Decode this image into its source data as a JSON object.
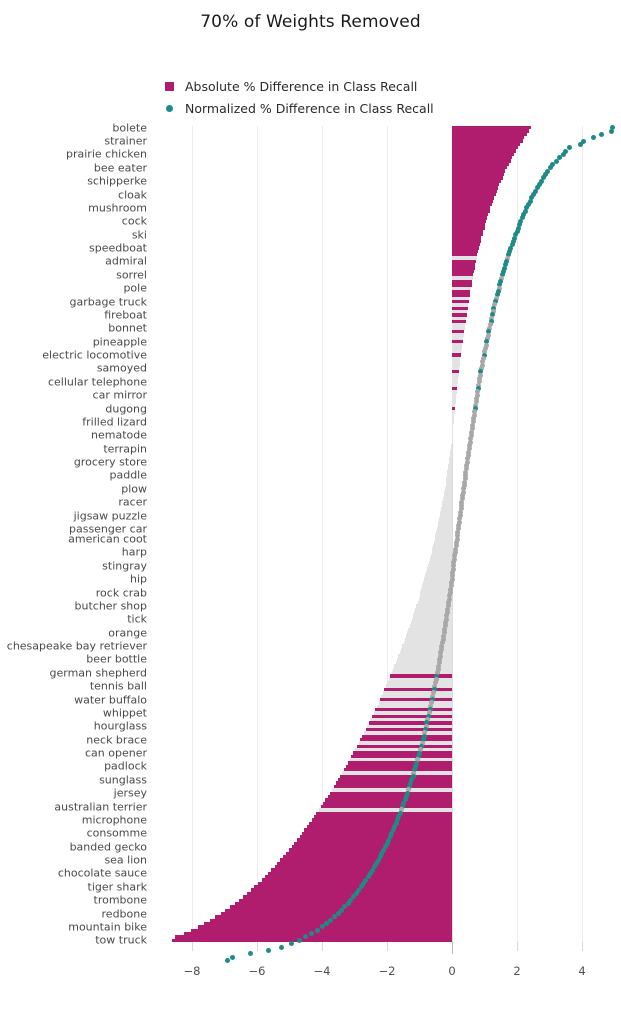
{
  "title": "70% of Weights Removed",
  "colors": {
    "absolute": "#b01c6e",
    "normalized": "#1f8a87",
    "nonsignificant_bar": "#e3e3e3",
    "nonsignificant_dot": "#a8a8a8",
    "grid": "#ececec",
    "background": "#ffffff"
  },
  "legend": {
    "position": "top-left",
    "items": [
      {
        "label": "Absolute % Difference in Class Recall",
        "marker": "square",
        "color": "#b01c6e"
      },
      {
        "label": "Normalized % Difference in Class Recall",
        "marker": "circle",
        "color": "#1f8a87"
      }
    ]
  },
  "xaxis": {
    "ticks": [
      -8,
      -6,
      -4,
      -2,
      0,
      2,
      4
    ],
    "tick_labels": [
      "−8",
      "−6",
      "−4",
      "−2",
      "0",
      "2",
      "4"
    ],
    "range": [
      -9.2,
      5.2
    ],
    "label": ""
  },
  "yaxis": {
    "label": "",
    "tick_labels": [
      "bolete",
      "strainer",
      "prairie chicken",
      "bee eater",
      "schipperke",
      "cloak",
      "mushroom",
      "cock",
      "ski",
      "speedboat",
      "admiral",
      "sorrel",
      "pole",
      "garbage truck",
      "fireboat",
      "bonnet",
      "pineapple",
      "electric locomotive",
      "samoyed",
      "cellular telephone",
      "car mirror",
      "dugong",
      "frilled lizard",
      "nematode",
      "terrapin",
      "grocery store",
      "paddle",
      "plow",
      "racer",
      "jigsaw puzzle",
      "passenger car",
      "american coot",
      "harp",
      "stingray",
      "hip",
      "rock crab",
      "butcher shop",
      "tick",
      "orange",
      "chesapeake bay retriever",
      "beer bottle",
      "german shepherd",
      "tennis ball",
      "water buffalo",
      "whippet",
      "hourglass",
      "neck brace",
      "can opener",
      "padlock",
      "sunglass",
      "jersey",
      "australian terrier",
      "microphone",
      "consomme",
      "banded gecko",
      "sea lion",
      "chocolate sauce",
      "tiger shark",
      "trombone",
      "redbone",
      "mountain bike",
      "tow truck"
    ]
  },
  "chart_data": {
    "type": "bar",
    "title": "70% of Weights Removed",
    "xlabel": "",
    "ylabel": "",
    "xlim": [
      -9.2,
      5.2
    ],
    "grid": true,
    "orientation": "horizontal",
    "n_rows": 248,
    "note": "Sorted diverging bar chart of per-class recall differences; bars = absolute % difference (magenta when significant, light grey otherwise), overlaid dots = normalized % difference (teal when significant, grey otherwise). Labelled ticks shown for every 4th row.",
    "series": [
      {
        "name": "Absolute % Difference in Class Recall",
        "color": "#b01c6e",
        "type": "bar",
        "values": [
          2.42,
          2.36,
          2.31,
          2.22,
          2.18,
          2.1,
          2.04,
          1.98,
          1.9,
          1.86,
          1.8,
          1.76,
          1.7,
          1.64,
          1.6,
          1.56,
          1.5,
          1.46,
          1.42,
          1.38,
          1.34,
          1.3,
          1.26,
          1.22,
          1.18,
          1.16,
          1.12,
          1.08,
          1.06,
          1.02,
          1.0,
          0.96,
          0.94,
          0.9,
          0.88,
          0.86,
          0.82,
          0.8,
          0.78,
          0.76,
          0.74,
          0.72,
          0.7,
          0.68,
          0.66,
          0.64,
          0.62,
          0.6,
          0.58,
          0.56,
          0.55,
          0.53,
          0.51,
          0.5,
          0.48,
          0.46,
          0.45,
          0.43,
          0.42,
          0.4,
          0.39,
          0.37,
          0.36,
          0.34,
          0.33,
          0.32,
          0.3,
          0.29,
          0.28,
          0.26,
          0.25,
          0.24,
          0.22,
          0.21,
          0.2,
          0.19,
          0.18,
          0.16,
          0.15,
          0.14,
          0.13,
          0.12,
          0.11,
          0.1,
          0.09,
          0.08,
          0.07,
          0.06,
          0.05,
          0.04,
          0.03,
          0.02,
          0.01,
          0.0,
          -0.01,
          -0.02,
          -0.04,
          -0.05,
          -0.06,
          -0.08,
          -0.09,
          -0.11,
          -0.12,
          -0.14,
          -0.15,
          -0.17,
          -0.19,
          -0.2,
          -0.22,
          -0.24,
          -0.26,
          -0.28,
          -0.3,
          -0.32,
          -0.34,
          -0.36,
          -0.38,
          -0.4,
          -0.42,
          -0.44,
          -0.46,
          -0.49,
          -0.51,
          -0.53,
          -0.56,
          -0.58,
          -0.61,
          -0.63,
          -0.66,
          -0.68,
          -0.71,
          -0.74,
          -0.76,
          -0.79,
          -0.82,
          -0.85,
          -0.88,
          -0.91,
          -0.94,
          -0.97,
          -1.0,
          -1.03,
          -1.06,
          -1.1,
          -1.13,
          -1.16,
          -1.2,
          -1.23,
          -1.27,
          -1.3,
          -1.34,
          -1.38,
          -1.41,
          -1.45,
          -1.49,
          -1.53,
          -1.57,
          -1.61,
          -1.65,
          -1.69,
          -1.73,
          -1.77,
          -1.81,
          -1.86,
          -1.9,
          -1.94,
          -1.99,
          -2.03,
          -2.08,
          -2.12,
          -2.17,
          -2.22,
          -2.26,
          -2.31,
          -2.36,
          -2.41,
          -2.46,
          -2.51,
          -2.56,
          -2.61,
          -2.66,
          -2.71,
          -2.77,
          -2.82,
          -2.87,
          -2.93,
          -2.98,
          -3.04,
          -3.1,
          -3.15,
          -3.21,
          -3.27,
          -3.33,
          -3.39,
          -3.45,
          -3.51,
          -3.57,
          -3.64,
          -3.7,
          -3.76,
          -3.83,
          -3.9,
          -3.96,
          -4.03,
          -4.1,
          -4.17,
          -4.24,
          -4.31,
          -4.39,
          -4.46,
          -4.54,
          -4.61,
          -4.69,
          -4.77,
          -4.85,
          -4.93,
          -5.02,
          -5.1,
          -5.19,
          -5.28,
          -5.37,
          -5.46,
          -5.56,
          -5.66,
          -5.76,
          -5.86,
          -5.97,
          -6.08,
          -6.19,
          -6.31,
          -6.43,
          -6.56,
          -6.69,
          -6.83,
          -6.97,
          -7.12,
          -7.28,
          -7.45,
          -7.63,
          -7.82,
          -8.03,
          -8.26,
          -8.52,
          -8.62
        ]
      },
      {
        "name": "Normalized % Difference in Class Recall",
        "color": "#1f8a87",
        "type": "scatter",
        "values": [
          4.95,
          4.9,
          4.6,
          4.35,
          4.05,
          3.95,
          3.6,
          3.5,
          3.42,
          3.3,
          3.2,
          3.1,
          3.02,
          2.95,
          2.88,
          2.8,
          2.74,
          2.68,
          2.62,
          2.56,
          2.5,
          2.45,
          2.4,
          2.35,
          2.3,
          2.25,
          2.2,
          2.16,
          2.12,
          2.08,
          2.04,
          2.0,
          1.96,
          1.92,
          1.88,
          1.85,
          1.81,
          1.78,
          1.74,
          1.71,
          1.68,
          1.65,
          1.62,
          1.59,
          1.56,
          1.53,
          1.5,
          1.47,
          1.45,
          1.42,
          1.39,
          1.37,
          1.34,
          1.32,
          1.29,
          1.27,
          1.24,
          1.22,
          1.2,
          1.17,
          1.15,
          1.13,
          1.11,
          1.09,
          1.07,
          1.05,
          1.03,
          1.01,
          0.99,
          0.97,
          0.95,
          0.93,
          0.91,
          0.89,
          0.88,
          0.86,
          0.84,
          0.82,
          0.81,
          0.79,
          0.77,
          0.76,
          0.74,
          0.72,
          0.71,
          0.69,
          0.68,
          0.66,
          0.65,
          0.63,
          0.62,
          0.6,
          0.59,
          0.57,
          0.56,
          0.54,
          0.53,
          0.51,
          0.5,
          0.48,
          0.47,
          0.46,
          0.44,
          0.43,
          0.41,
          0.4,
          0.39,
          0.37,
          0.36,
          0.34,
          0.33,
          0.32,
          0.3,
          0.29,
          0.28,
          0.26,
          0.25,
          0.24,
          0.22,
          0.21,
          0.2,
          0.18,
          0.17,
          0.16,
          0.14,
          0.13,
          0.12,
          0.1,
          0.09,
          0.08,
          0.06,
          0.05,
          0.04,
          0.02,
          0.01,
          0.0,
          -0.02,
          -0.03,
          -0.04,
          -0.06,
          -0.07,
          -0.09,
          -0.1,
          -0.12,
          -0.13,
          -0.15,
          -0.16,
          -0.18,
          -0.19,
          -0.21,
          -0.22,
          -0.24,
          -0.26,
          -0.27,
          -0.29,
          -0.31,
          -0.32,
          -0.34,
          -0.36,
          -0.38,
          -0.39,
          -0.41,
          -0.43,
          -0.45,
          -0.47,
          -0.49,
          -0.51,
          -0.53,
          -0.55,
          -0.57,
          -0.59,
          -0.61,
          -0.63,
          -0.65,
          -0.67,
          -0.7,
          -0.72,
          -0.74,
          -0.77,
          -0.79,
          -0.81,
          -0.84,
          -0.86,
          -0.89,
          -0.92,
          -0.94,
          -0.97,
          -1.0,
          -1.02,
          -1.05,
          -1.08,
          -1.11,
          -1.14,
          -1.17,
          -1.2,
          -1.24,
          -1.27,
          -1.3,
          -1.34,
          -1.37,
          -1.41,
          -1.44,
          -1.48,
          -1.52,
          -1.56,
          -1.6,
          -1.64,
          -1.68,
          -1.72,
          -1.77,
          -1.81,
          -1.86,
          -1.9,
          -1.95,
          -2.0,
          -2.05,
          -2.1,
          -2.16,
          -2.21,
          -2.27,
          -2.33,
          -2.39,
          -2.45,
          -2.51,
          -2.58,
          -2.65,
          -2.72,
          -2.79,
          -2.87,
          -2.95,
          -3.03,
          -3.11,
          -3.2,
          -3.3,
          -3.4,
          -3.5,
          -3.61,
          -3.73,
          -3.86,
          -4.0,
          -4.15,
          -4.32,
          -4.5,
          -4.7,
          -4.95,
          -5.25,
          -5.65,
          -6.2,
          -6.75,
          -6.9
        ]
      }
    ],
    "significant_flags": [
      1,
      1,
      1,
      1,
      1,
      1,
      1,
      1,
      1,
      1,
      1,
      1,
      1,
      1,
      1,
      1,
      1,
      1,
      1,
      1,
      1,
      1,
      1,
      1,
      1,
      1,
      1,
      1,
      1,
      1,
      1,
      1,
      1,
      1,
      1,
      1,
      1,
      1,
      1,
      0,
      1,
      1,
      1,
      1,
      1,
      0,
      1,
      1,
      0,
      1,
      1,
      0,
      1,
      0,
      1,
      0,
      1,
      0,
      1,
      0,
      0,
      1,
      0,
      0,
      1,
      0,
      0,
      0,
      1,
      0,
      0,
      0,
      0,
      1,
      0,
      0,
      0,
      0,
      1,
      0,
      0,
      0,
      0,
      0,
      1,
      0,
      0,
      0,
      0,
      0,
      0,
      0,
      0,
      0,
      0,
      0,
      0,
      0,
      0,
      0,
      0,
      0,
      0,
      0,
      0,
      0,
      0,
      0,
      0,
      0,
      0,
      0,
      0,
      0,
      0,
      0,
      0,
      0,
      0,
      0,
      0,
      0,
      0,
      0,
      0,
      0,
      0,
      0,
      0,
      0,
      0,
      0,
      0,
      0,
      0,
      0,
      0,
      0,
      0,
      0,
      0,
      0,
      0,
      0,
      0,
      0,
      0,
      0,
      0,
      0,
      0,
      0,
      0,
      0,
      0,
      0,
      0,
      0,
      0,
      0,
      0,
      0,
      0,
      0,
      1,
      0,
      0,
      0,
      1,
      0,
      0,
      1,
      0,
      0,
      1,
      0,
      1,
      0,
      1,
      0,
      1,
      0,
      1,
      1,
      0,
      1,
      0,
      1,
      1,
      0,
      1,
      1,
      1,
      0,
      1,
      1,
      1,
      1,
      0,
      1,
      1,
      1,
      1,
      1,
      0,
      1,
      1,
      1,
      1,
      1,
      1,
      1,
      1,
      1,
      1,
      1,
      1,
      1,
      1,
      1,
      1,
      1,
      1,
      1,
      1,
      1,
      1,
      1,
      1,
      1,
      1,
      1,
      1,
      1,
      1,
      1,
      1,
      1,
      1,
      1,
      1,
      1,
      1,
      1,
      1,
      1,
      1,
      1,
      1,
      1,
      1,
      1
    ]
  }
}
